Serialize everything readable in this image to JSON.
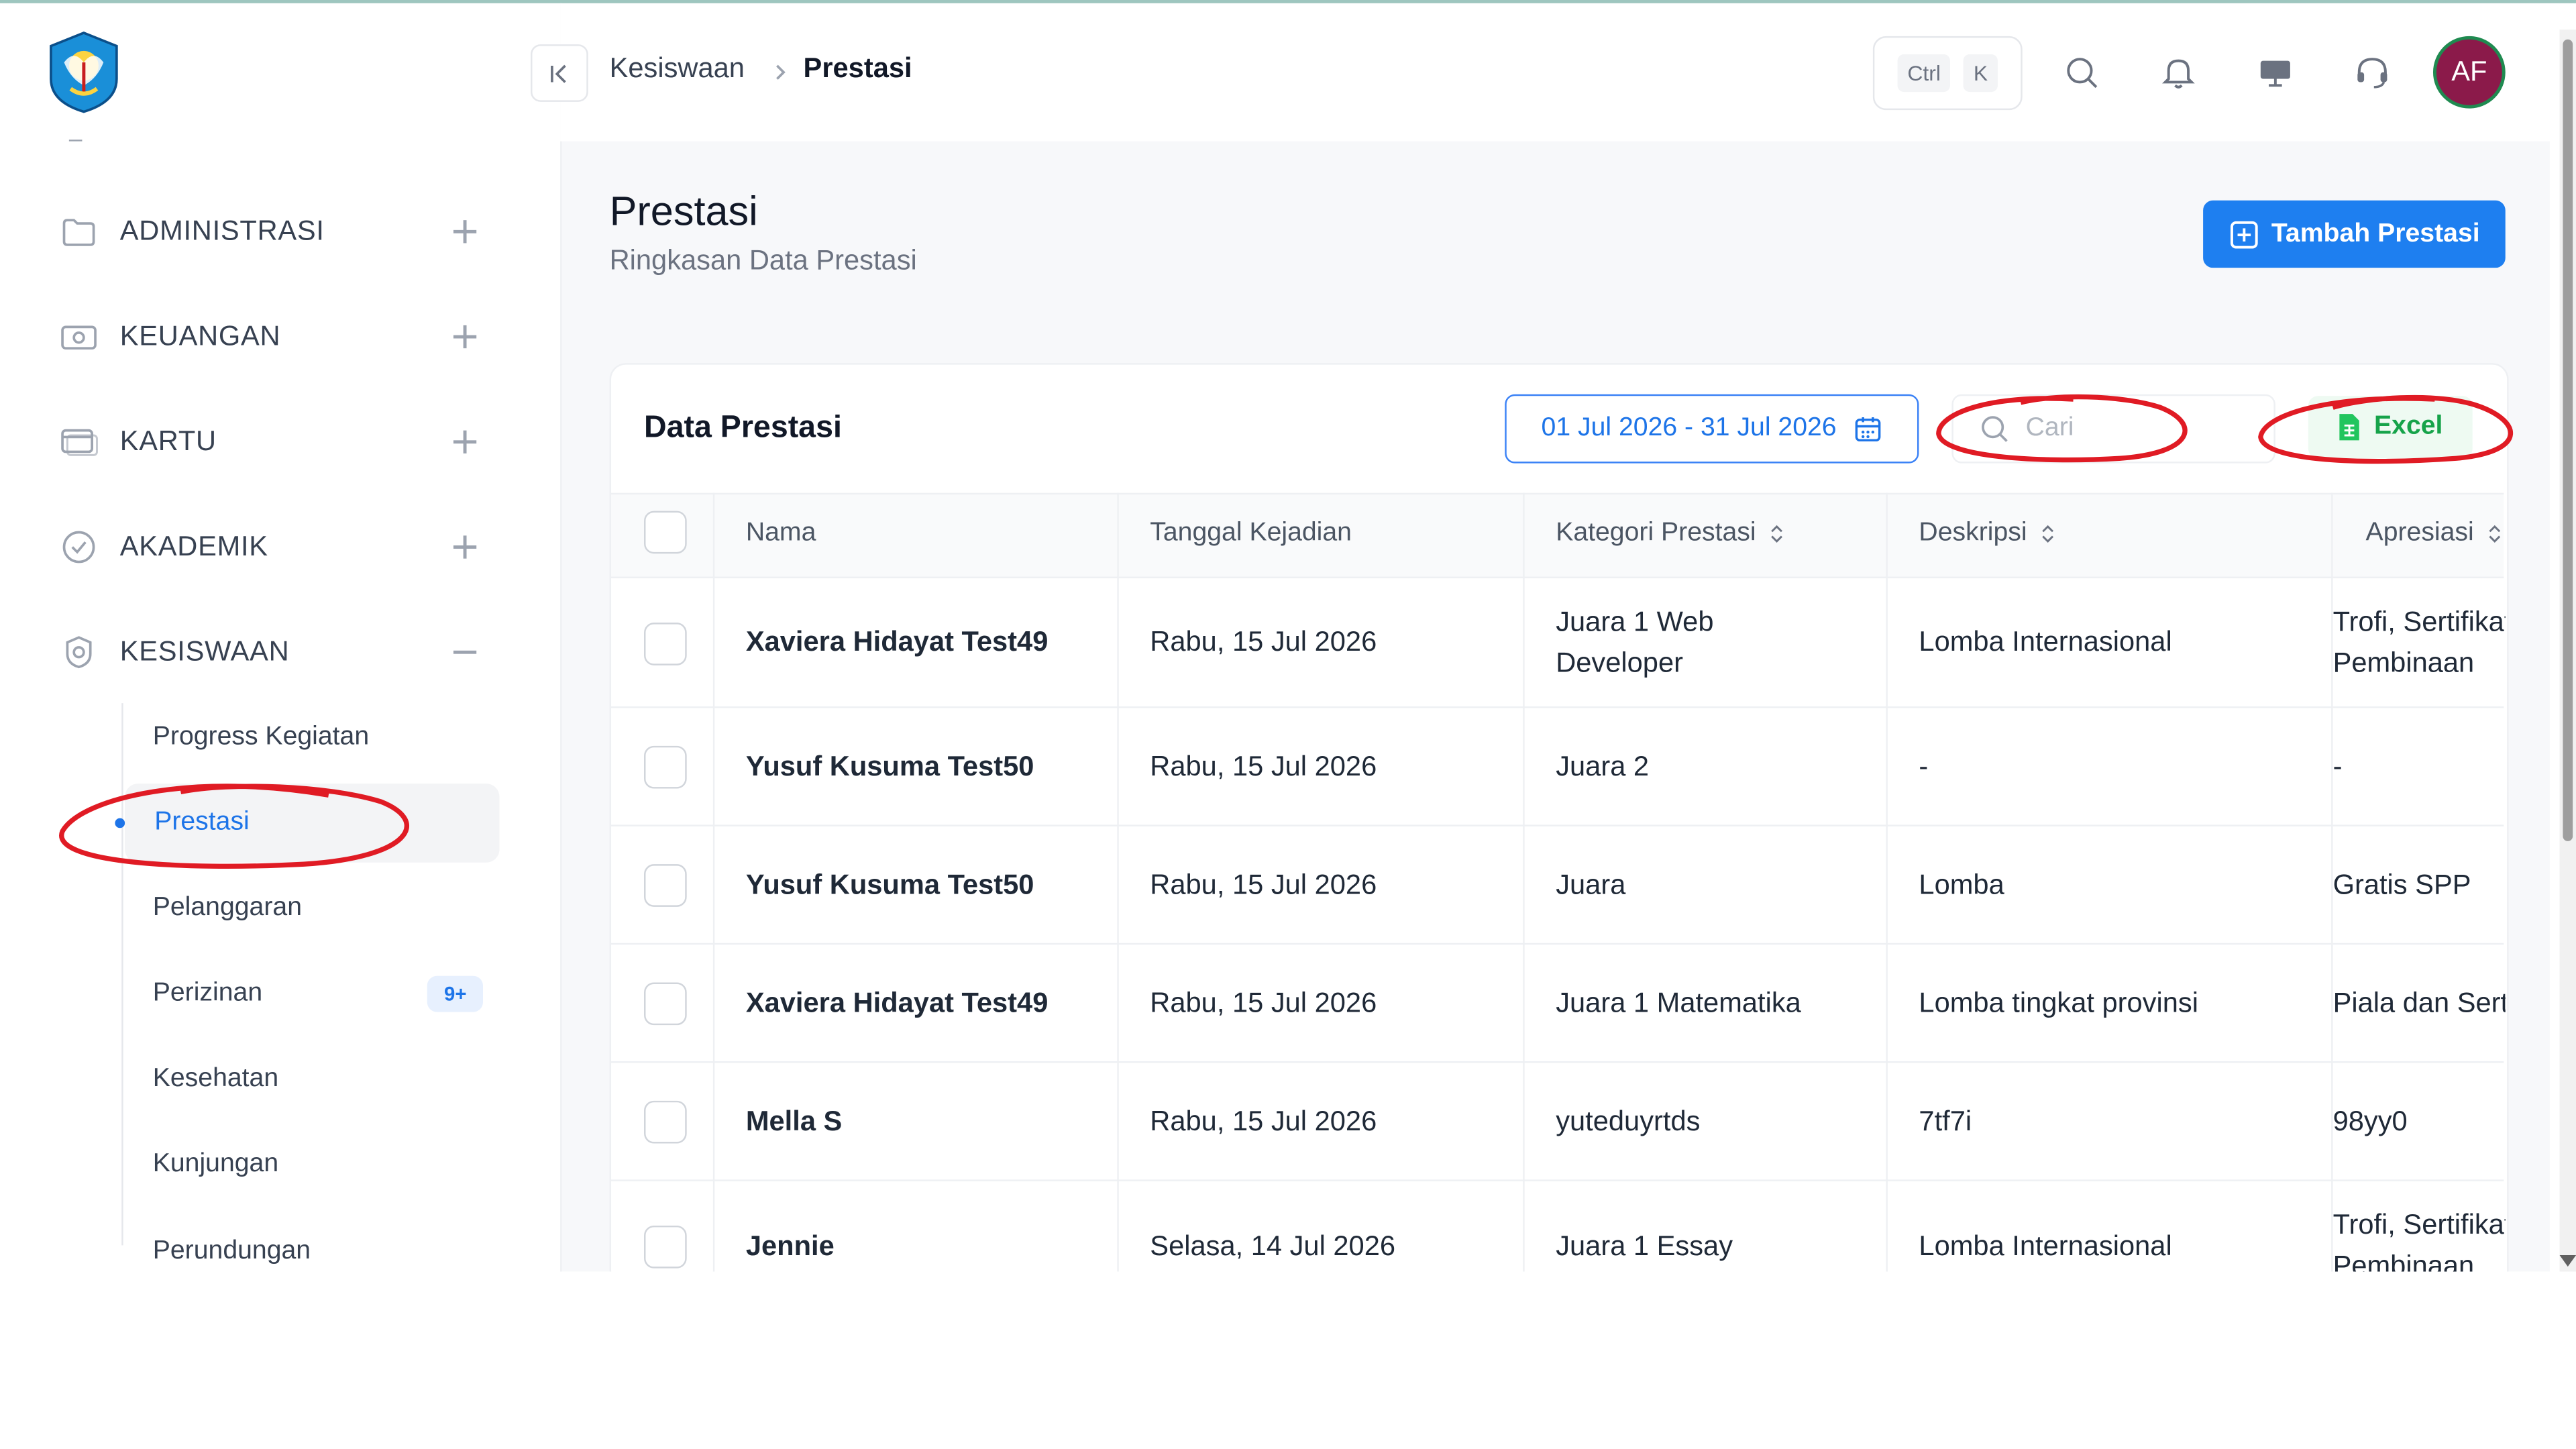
{
  "colors": {
    "accent": "#1e7ff0",
    "excel_green": "#16a34a",
    "annotation_red": "#e01b24",
    "avatar_bg": "#8b1a4a"
  },
  "sidebar": {
    "logo_icon": "tut-wuri-handayani-logo",
    "menu": [
      {
        "label": "ADMINISTRASI",
        "icon": "folder-icon",
        "toggle": "plus"
      },
      {
        "label": "KEUANGAN",
        "icon": "money-icon",
        "toggle": "plus"
      },
      {
        "label": "KARTU",
        "icon": "card-icon",
        "toggle": "plus"
      },
      {
        "label": "AKADEMIK",
        "icon": "badge-icon",
        "toggle": "plus"
      },
      {
        "label": "KESISWAAN",
        "icon": "student-icon",
        "toggle": "minus"
      }
    ],
    "submenu": [
      {
        "label": "Progress Kegiatan"
      },
      {
        "label": "Prestasi",
        "active": true
      },
      {
        "label": "Pelanggaran"
      },
      {
        "label": "Perizinan",
        "badge": "9+"
      },
      {
        "label": "Kesehatan"
      },
      {
        "label": "Kunjungan"
      },
      {
        "label": "Perundungan"
      }
    ]
  },
  "header": {
    "breadcrumb": [
      "Kesiswaan",
      "Prestasi"
    ],
    "shortcut": [
      "Ctrl",
      "K"
    ],
    "icons": [
      "search-icon",
      "bell-icon",
      "monitor-icon",
      "headset-icon"
    ],
    "avatar_initials": "AF"
  },
  "page": {
    "title": "Prestasi",
    "subtitle": "Ringkasan Data Prestasi",
    "add_button": "Tambah Prestasi"
  },
  "card": {
    "title": "Data Prestasi",
    "date_range": "01 Jul 2026 - 31 Jul 2026",
    "search_placeholder": "Cari",
    "excel_label": "Excel"
  },
  "table": {
    "columns": [
      "Nama",
      "Tanggal Kejadian",
      "Kategori Prestasi",
      "Deskripsi",
      "Apresiasi"
    ],
    "sortable": [
      false,
      false,
      true,
      true,
      true
    ],
    "rows": [
      {
        "nama": "Xaviera Hidayat Test49",
        "tanggal": "Rabu, 15 Jul 2026",
        "kategori": [
          "Juara 1 Web",
          "Developer"
        ],
        "deskripsi": "Lomba Internasional",
        "apresiasi": [
          "Trofi, Sertifikat,",
          "Pembinaan"
        ]
      },
      {
        "nama": "Yusuf Kusuma Test50",
        "tanggal": "Rabu, 15 Jul 2026",
        "kategori": [
          "Juara 2"
        ],
        "deskripsi": "-",
        "apresiasi": [
          "-"
        ]
      },
      {
        "nama": "Yusuf Kusuma Test50",
        "tanggal": "Rabu, 15 Jul 2026",
        "kategori": [
          "Juara"
        ],
        "deskripsi": "Lomba",
        "apresiasi": [
          "Gratis SPP"
        ]
      },
      {
        "nama": "Xaviera Hidayat Test49",
        "tanggal": "Rabu, 15 Jul 2026",
        "kategori": [
          "Juara 1 Matematika"
        ],
        "deskripsi": "Lomba tingkat provinsi",
        "apresiasi": [
          "Piala dan Sertifikat"
        ]
      },
      {
        "nama": "Mella S",
        "tanggal": "Rabu, 15 Jul 2026",
        "kategori": [
          "yuteduyrtds"
        ],
        "deskripsi": "7tf7i",
        "apresiasi": [
          "98yy0"
        ]
      },
      {
        "nama": "Jennie",
        "tanggal": "Selasa, 14 Jul 2026",
        "kategori": [
          "Juara 1 Essay"
        ],
        "deskripsi": "Lomba Internasional",
        "apresiasi": [
          "Trofi, Sertifikat,",
          "Pembinaan"
        ]
      }
    ]
  }
}
